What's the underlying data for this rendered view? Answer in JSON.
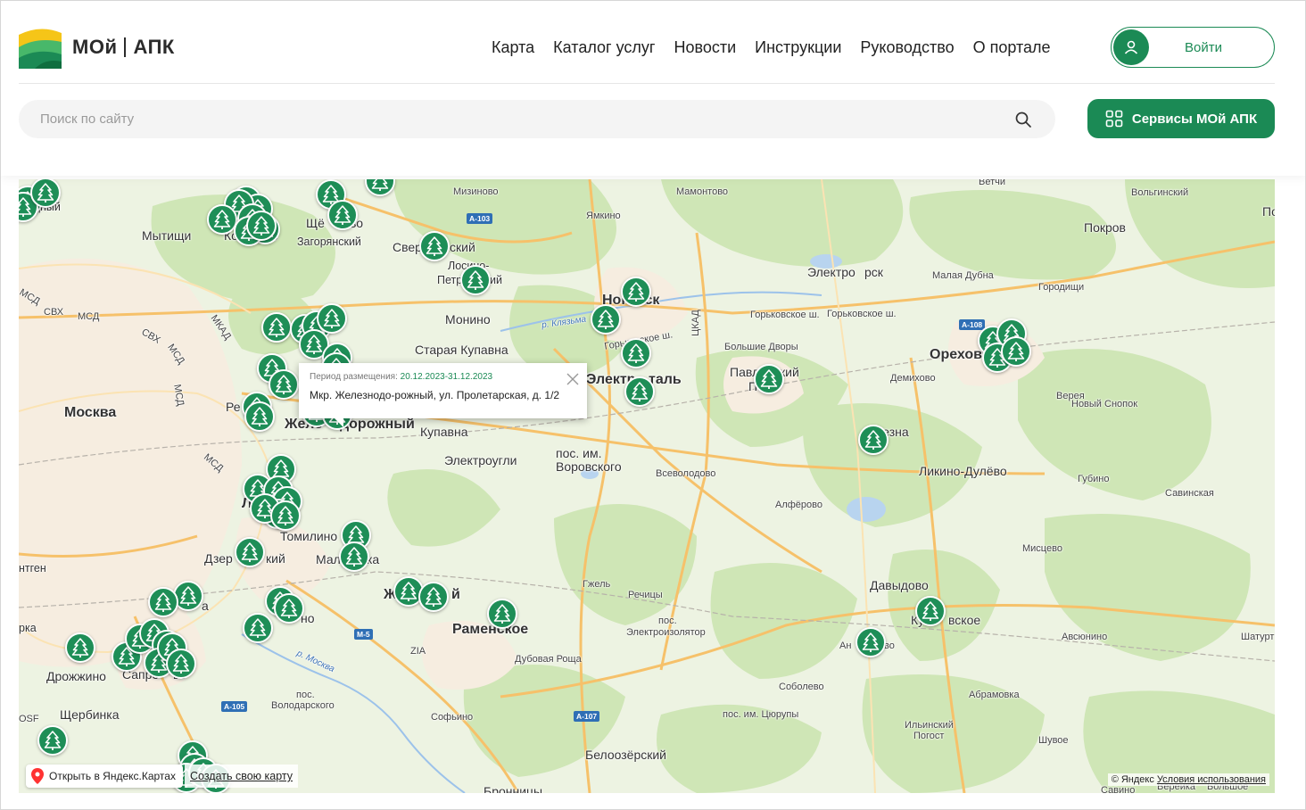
{
  "header": {
    "logo": {
      "part1": "МОй",
      "part2": "АПК"
    },
    "nav": [
      "Карта",
      "Каталог услуг",
      "Новости",
      "Инструкции",
      "Руководство",
      "О портале"
    ],
    "login_label": "Войти",
    "search_placeholder": "Поиск по сайту",
    "services_label": "Сервисы МОй АПК",
    "brand_color": "#1b8a55"
  },
  "map": {
    "places": [
      {
        "name": "рудный",
        "cls": ""
      },
      {
        "name": "Мытищи",
        "cls": "city"
      },
      {
        "name": "Ко",
        "cls": "city"
      },
      {
        "name": "в",
        "cls": "city"
      },
      {
        "name": "Щё",
        "cls": "city"
      },
      {
        "name": "во",
        "cls": "city"
      },
      {
        "name": "Загорянский",
        "cls": ""
      },
      {
        "name": "Свер",
        "cls": "city"
      },
      {
        "name": "ский",
        "cls": "city"
      },
      {
        "name": "Мизиново",
        "cls": "sm"
      },
      {
        "name": "Мамонтово",
        "cls": "sm"
      },
      {
        "name": "Ветчи",
        "cls": "sm"
      },
      {
        "name": "Вольгинский",
        "cls": "sm"
      },
      {
        "name": "По",
        "cls": "city"
      },
      {
        "name": "Покров",
        "cls": "city"
      },
      {
        "name": "Ямкино",
        "cls": "sm"
      },
      {
        "name": "Лосино-",
        "cls": ""
      },
      {
        "name": "Петр",
        "cls": ""
      },
      {
        "name": "ий",
        "cls": ""
      },
      {
        "name": "Электро",
        "cls": "city"
      },
      {
        "name": "рск",
        "cls": "city"
      },
      {
        "name": "Малая Дубна",
        "cls": "sm"
      },
      {
        "name": "Городищи",
        "cls": "sm"
      },
      {
        "name": "Ногинск",
        "cls": "big"
      },
      {
        "name": "Монино",
        "cls": "city"
      },
      {
        "name": "Горьковское ш.",
        "cls": "sm"
      },
      {
        "name": "Горьковское ш.",
        "cls": "sm"
      },
      {
        "name": "Старая Купавна",
        "cls": "city"
      },
      {
        "name": "Большие Дворы",
        "cls": "sm"
      },
      {
        "name": "Ореховo",
        "cls": "big"
      },
      {
        "name": "во",
        "cls": "big"
      },
      {
        "name": "Павл",
        "cls": "city"
      },
      {
        "name": "ский",
        "cls": "city"
      },
      {
        "name": "По",
        "cls": "city"
      },
      {
        "name": "Москва",
        "cls": "big"
      },
      {
        "name": "Ре",
        "cls": "city"
      },
      {
        "name": "Электр",
        "cls": "big"
      },
      {
        "name": "таль",
        "cls": "big"
      },
      {
        "name": "Демихово",
        "cls": "sm"
      },
      {
        "name": "Верея",
        "cls": "sm"
      },
      {
        "name": "Новый Снопок",
        "cls": "sm"
      },
      {
        "name": "Желе",
        "cls": "big"
      },
      {
        "name": "дорожный",
        "cls": "big"
      },
      {
        "name": "Купавна",
        "cls": "city"
      },
      {
        "name": "Дрезна",
        "cls": "city"
      },
      {
        "name": "пос. им.",
        "cls": "city"
      },
      {
        "name": "Воровского",
        "cls": "city"
      },
      {
        "name": "Электроугли",
        "cls": "city"
      },
      {
        "name": "Всеволодово",
        "cls": "sm"
      },
      {
        "name": "Ликино-Дулёво",
        "cls": "city"
      },
      {
        "name": "Губино",
        "cls": "sm"
      },
      {
        "name": "Савинская",
        "cls": "sm"
      },
      {
        "name": "Л",
        "cls": "big"
      },
      {
        "name": "Алфёрово",
        "cls": "sm"
      },
      {
        "name": "Томилино",
        "cls": "city"
      },
      {
        "name": "Мисцево",
        "cls": "sm"
      },
      {
        "name": "Дзер",
        "cls": "city"
      },
      {
        "name": "кий",
        "cls": "city"
      },
      {
        "name": "Мал",
        "cls": "city"
      },
      {
        "name": "ка",
        "cls": "city"
      },
      {
        "name": "нтген",
        "cls": ""
      },
      {
        "name": "Ж",
        "cls": "big"
      },
      {
        "name": "й",
        "cls": "big"
      },
      {
        "name": "Гжель",
        "cls": "sm"
      },
      {
        "name": "Речицы",
        "cls": "sm"
      },
      {
        "name": "Давыдово",
        "cls": "city"
      },
      {
        "name": "Ку",
        "cls": "city"
      },
      {
        "name": "вское",
        "cls": "city"
      },
      {
        "name": "а",
        "cls": "city"
      },
      {
        "name": "но",
        "cls": "city"
      },
      {
        "name": "Раменское",
        "cls": "big"
      },
      {
        "name": "пос.",
        "cls": "sm"
      },
      {
        "name": "Электроизолятор",
        "cls": "sm"
      },
      {
        "name": "Авсюнино",
        "cls": "sm"
      },
      {
        "name": "Шатурт",
        "cls": "sm"
      },
      {
        "name": "рка",
        "cls": ""
      },
      {
        "name": "Ан",
        "cls": "sm"
      },
      {
        "name": "во",
        "cls": "sm"
      },
      {
        "name": "Дрожжино",
        "cls": "city"
      },
      {
        "name": "Сапро",
        "cls": "city"
      },
      {
        "name": "во",
        "cls": "city"
      },
      {
        "name": "Дубовая Роща",
        "cls": "sm"
      },
      {
        "name": "Соболево",
        "cls": "sm"
      },
      {
        "name": "Абрамовка",
        "cls": "sm"
      },
      {
        "name": "пос.",
        "cls": "sm"
      },
      {
        "name": "Володарского",
        "cls": "sm"
      },
      {
        "name": "Щербинка",
        "cls": "city"
      },
      {
        "name": "Софьино",
        "cls": "sm"
      },
      {
        "name": "пос. им. Цюрупы",
        "cls": "sm"
      },
      {
        "name": "Ильинский",
        "cls": "sm"
      },
      {
        "name": "Погост",
        "cls": "sm"
      },
      {
        "name": "Шувое",
        "cls": "sm"
      },
      {
        "name": "Белоозёрский",
        "cls": "city"
      },
      {
        "name": "Бронницы",
        "cls": "city"
      },
      {
        "name": "Вереика",
        "cls": "sm"
      },
      {
        "name": "Большое",
        "cls": "sm"
      },
      {
        "name": "Савино",
        "cls": "sm"
      },
      {
        "name": "Фр",
        "cls": "sm"
      },
      {
        "name": "МСД",
        "cls": "sm"
      },
      {
        "name": "СВХ",
        "cls": "sm"
      },
      {
        "name": "МСД",
        "cls": "sm"
      },
      {
        "name": "СВХ",
        "cls": "sm"
      },
      {
        "name": "МКАД",
        "cls": "sm"
      },
      {
        "name": "МСД",
        "cls": "sm"
      },
      {
        "name": "МСД",
        "cls": "sm"
      },
      {
        "name": "МСД",
        "cls": "sm"
      },
      {
        "name": "ЦКАД",
        "cls": "sm"
      },
      {
        "name": "р. Клязьма",
        "cls": "river"
      },
      {
        "name": "р. Москва",
        "cls": "river"
      },
      {
        "name": "ZIA",
        "cls": "sm"
      },
      {
        "name": "OSF",
        "cls": "sm"
      },
      {
        "name": "Горьковское ш.",
        "cls": "sm"
      }
    ],
    "roads": [
      "A-103",
      "A-108",
      "M-5",
      "A-105",
      "A-107"
    ],
    "marker_count": 80,
    "balloon": {
      "period_label": "Период размещения:",
      "period_dates": "20.12.2023-31.12.2023",
      "address": "Мкр. Железнодо-рожный, ул. Пролетарская, д. 1/2"
    },
    "open_yandex": "Открыть в Яндекс.Картах",
    "create_map": "Создать свою карту",
    "copyright_prefix": "© Яндекс",
    "terms": "Условия использования"
  }
}
